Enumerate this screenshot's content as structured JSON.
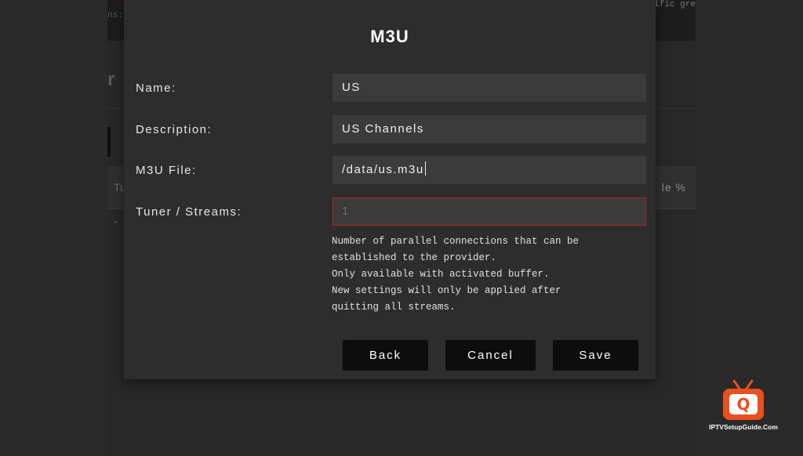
{
  "background": {
    "topbar_left": "ns:",
    "topbar_right": "cific gre",
    "title_fragment": "r",
    "row_left": "Tu",
    "row_right": "le %",
    "dash": "-"
  },
  "modal": {
    "title": "M3U",
    "fields": [
      {
        "label": "Name:",
        "value": "US"
      },
      {
        "label": "Description:",
        "value": "US Channels"
      },
      {
        "label": "M3U File:",
        "value": "/data/us.m3u"
      },
      {
        "label": "Tuner / Streams:",
        "placeholder": "1"
      }
    ],
    "hint_lines": [
      "Number of parallel connections that can be",
      "established to the provider.",
      "Only available with activated buffer.",
      "New settings will only be applied after",
      "quitting all streams."
    ],
    "buttons": {
      "back": "Back",
      "cancel": "Cancel",
      "save": "Save"
    }
  },
  "watermark": {
    "icon": "tv-magnifier-logo",
    "text": "IPTVSetupGuide.Com",
    "accent_color": "#e8501f"
  },
  "colors": {
    "error_border": "#b3261e",
    "modal_bg": "#2d2d2d",
    "button_bg": "#0d0d0d"
  }
}
